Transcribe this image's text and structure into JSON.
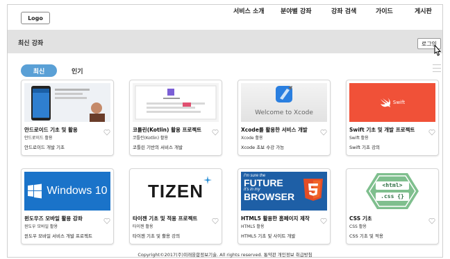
{
  "header": {
    "logo_label": "Logo",
    "nav": [
      "서비스 소개",
      "분야별 강좌",
      "강좌 검색",
      "가이드",
      "게시판"
    ]
  },
  "subheader": {
    "title": "최신 강좌",
    "login_label": "로그인"
  },
  "tabs": {
    "active": "최신",
    "other": "인기"
  },
  "courses": [
    {
      "title": "안드로이드 기초 및 활용",
      "author": "안드로이드 활용",
      "desc": "안드로이드 개발 기초",
      "thumb": "android"
    },
    {
      "title": "코틀린(Kotlin) 활용 프로젝트",
      "author": "코틀린(Kotlin) 활용",
      "desc": "코틀린 기반의 서비스 개발",
      "thumb": "kotlin"
    },
    {
      "title": "Xcode를 활용한 서비스 개발",
      "author": "Xcode 활용",
      "desc": "Xcode 초보 수강 가능",
      "thumb": "xcode",
      "thumb_text": "Welcome to Xcode"
    },
    {
      "title": "Swift 기초 및 개발 프로젝트",
      "author": "Swift 활용",
      "desc": "Swift 기초 강의",
      "thumb": "swift",
      "thumb_text": "Swift"
    },
    {
      "title": "윈도우즈 모바일 활용 강좌",
      "author": "윈도우 모바일 활용",
      "desc": "윈도우 모바일 서비스 개발 프로젝트",
      "thumb": "windows",
      "thumb_text": "Windows 10"
    },
    {
      "title": "타이젠 기초 및 적용 프로젝트",
      "author": "타이젠 활용",
      "desc": "타이젠 기초 및 활용 강의",
      "thumb": "tizen",
      "thumb_text": "TIZEN"
    },
    {
      "title": "HTML5 활용한 홈페이지 제작",
      "author": "HTML5 활용",
      "desc": "HTML5 기초 및 사이트 개발",
      "thumb": "html5",
      "thumb_text": [
        "I'm sure the",
        "FUTURE",
        "It's in my",
        "BROWSER"
      ]
    },
    {
      "title": "CSS 기초",
      "author": "CSS 활용",
      "desc": "CSS 기초 및 적용",
      "thumb": "css",
      "thumb_text": [
        "<html>",
        ".css {}"
      ]
    }
  ],
  "footer": "Copyright©2017(주)미래융합정보기술. All rights reserved. 통약관 개인정보 취급방침",
  "colors": {
    "accent": "#5aa0d6",
    "subheader_bg": "#e2e2e2",
    "swift": "#f05138",
    "windows": "#1a73c9",
    "html5": "#e44d26",
    "html5_bg": "#1e5fa6",
    "css": "#7fbf8e"
  }
}
